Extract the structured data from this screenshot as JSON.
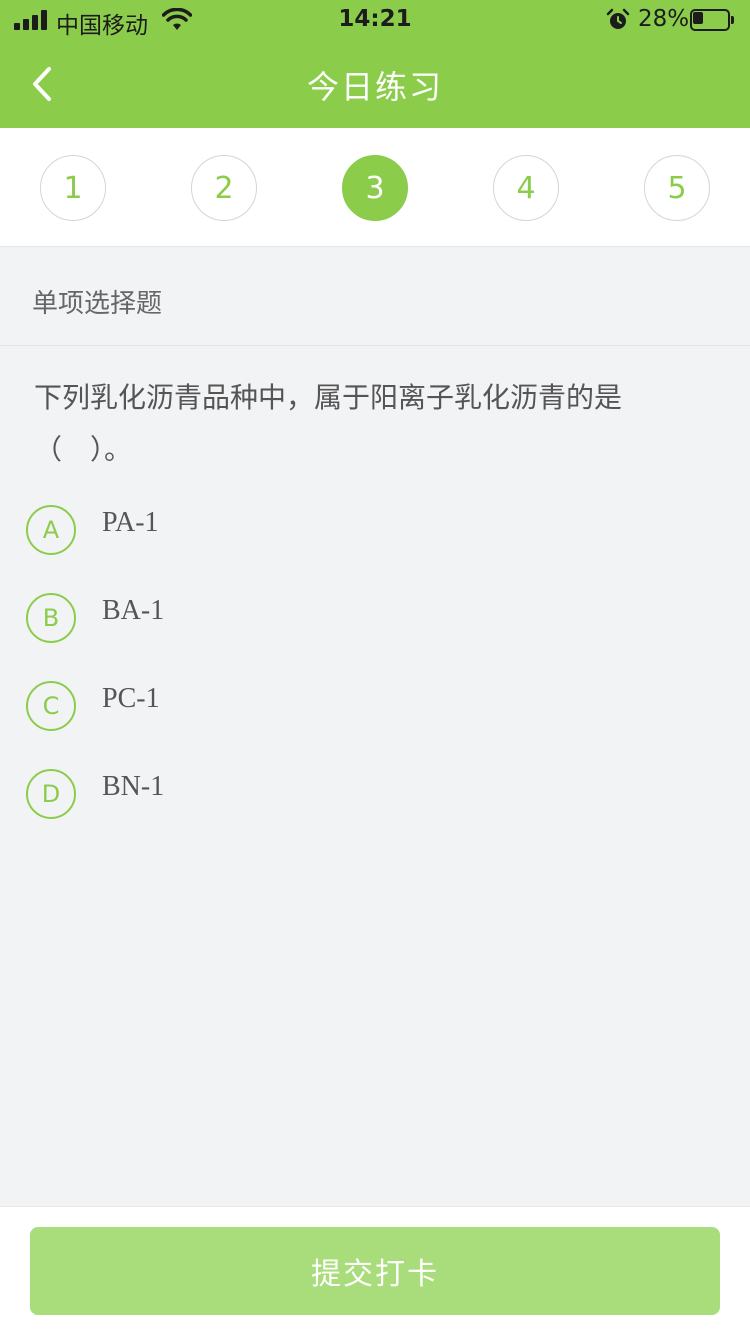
{
  "status_bar": {
    "carrier": "中国移动",
    "time": "14:21",
    "battery_percent_label": "28%",
    "battery_level": 0.28
  },
  "nav": {
    "title": "今日练习",
    "back_icon": "chevron-left-icon"
  },
  "steps": [
    {
      "label": "1",
      "active": false
    },
    {
      "label": "2",
      "active": false
    },
    {
      "label": "3",
      "active": true
    },
    {
      "label": "4",
      "active": false
    },
    {
      "label": "5",
      "active": false
    }
  ],
  "question": {
    "type": "单项选择题",
    "text": "下列乳化沥青品种中，属于阳离子乳化沥青的是（　）。",
    "options": [
      {
        "letter": "A",
        "text": "PA-1"
      },
      {
        "letter": "B",
        "text": "BA-1"
      },
      {
        "letter": "C",
        "text": "PC-1"
      },
      {
        "letter": "D",
        "text": "BN-1"
      }
    ]
  },
  "footer": {
    "submit_label": "提交打卡"
  },
  "colors": {
    "accent": "#8bcd4b",
    "submit_bg": "#a9dc7a",
    "page_bg": "#f2f3f5"
  }
}
